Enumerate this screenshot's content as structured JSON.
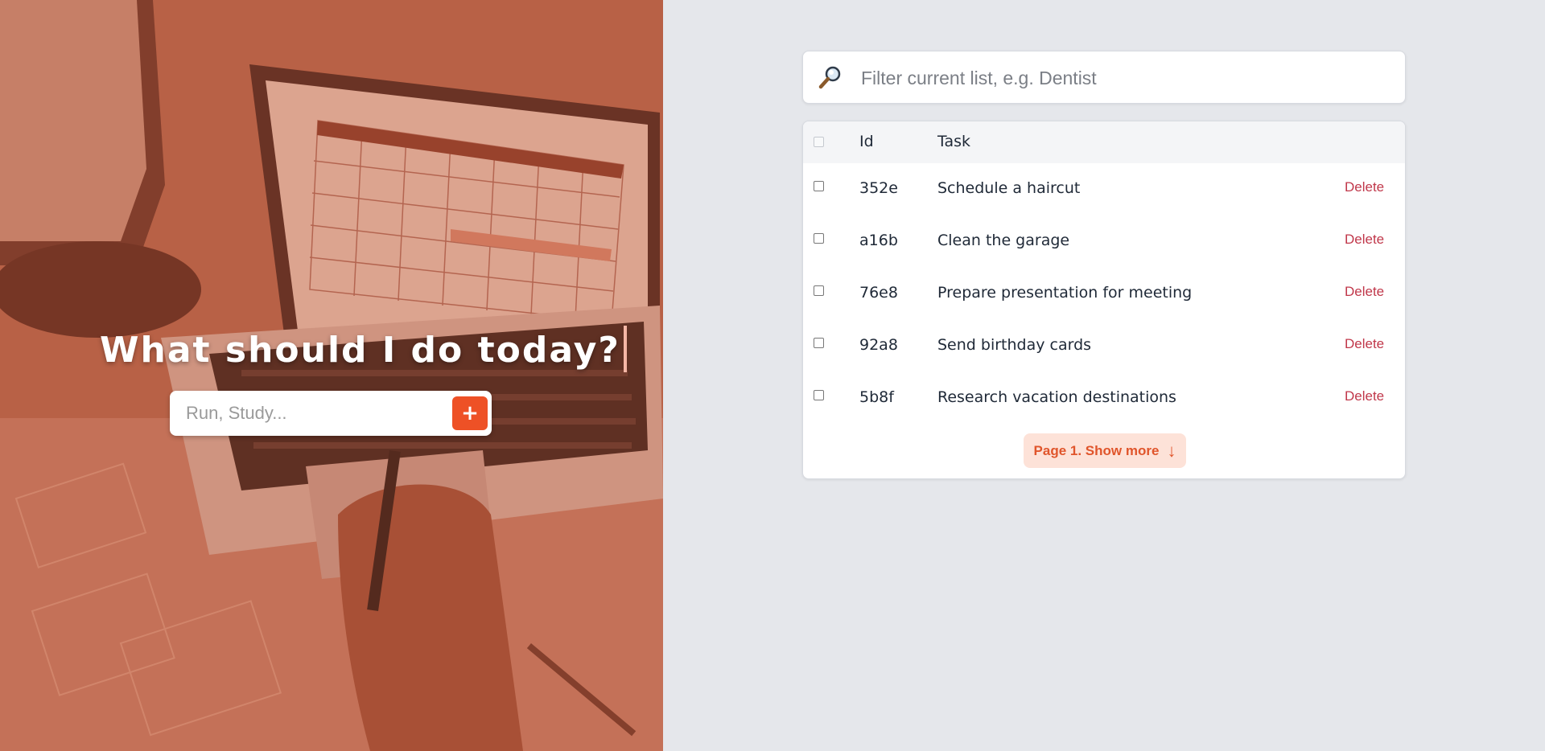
{
  "hero": {
    "title": "What should I do today?",
    "add_input_placeholder": "Run, Study...",
    "add_button_label": "+"
  },
  "filter": {
    "placeholder": "Filter current list, e.g. Dentist",
    "icon": "magnifying-glass-icon"
  },
  "table": {
    "headers": {
      "id": "Id",
      "task": "Task"
    },
    "rows": [
      {
        "id": "352e",
        "task": "Schedule a haircut",
        "action": "Delete"
      },
      {
        "id": "a16b",
        "task": "Clean the garage",
        "action": "Delete"
      },
      {
        "id": "76e8",
        "task": "Prepare presentation for meeting",
        "action": "Delete"
      },
      {
        "id": "92a8",
        "task": "Send birthday cards",
        "action": "Delete"
      },
      {
        "id": "5b8f",
        "task": "Research vacation destinations",
        "action": "Delete"
      }
    ],
    "show_more_label": "Page 1. Show more",
    "show_more_icon": "↓"
  },
  "colors": {
    "accent": "#ee5126",
    "delete": "#c0374a",
    "panel_bg": "#e5e7eb"
  }
}
